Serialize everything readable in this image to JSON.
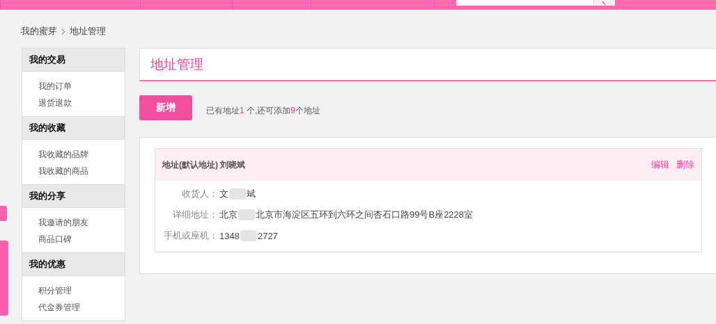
{
  "breadcrumb": [
    {
      "label": "我的蜜芽"
    },
    {
      "label": "地址管理"
    }
  ],
  "sidebar": {
    "groups": [
      {
        "title": "我的交易",
        "items": [
          {
            "label": "我的订单",
            "selected": false
          },
          {
            "label": "退货退款",
            "selected": false
          }
        ]
      },
      {
        "title": "我的收藏",
        "items": [
          {
            "label": "我收藏的品牌",
            "selected": false
          },
          {
            "label": "我收藏的商品",
            "selected": false
          }
        ]
      },
      {
        "title": "我的分享",
        "items": [
          {
            "label": "我邀请的朋友",
            "selected": false
          },
          {
            "label": "商品口碑",
            "selected": false
          }
        ]
      },
      {
        "title": "我的优惠",
        "items": [
          {
            "label": "积分管理",
            "selected": false
          },
          {
            "label": "代金券管理",
            "selected": false
          }
        ]
      }
    ]
  },
  "page_title": "地址管理",
  "add_button": "新增",
  "address_count": [
    {
      "text": "已有地址",
      "highlight": false
    },
    {
      "text": "1",
      "highlight": true
    },
    {
      "text": " 个,还可添加",
      "highlight": false
    },
    {
      "text": "9",
      "highlight": true
    },
    {
      "text": "个地址",
      "highlight": false
    }
  ],
  "addresses": [
    {
      "heading": "地址(默认地址) 刘晓斌",
      "actions": [
        "编辑",
        "删除"
      ],
      "fields": [
        {
          "label": "收货人：",
          "value_parts": [
            "文",
            "斌"
          ]
        },
        {
          "label": "详细地址：",
          "value_parts": [
            "北京",
            "北京市海淀区五环到六环之间杏石口路99号B座2228室"
          ]
        },
        {
          "label": "手机或座机：",
          "value_parts": [
            "1348",
            "2727"
          ]
        }
      ]
    }
  ]
}
